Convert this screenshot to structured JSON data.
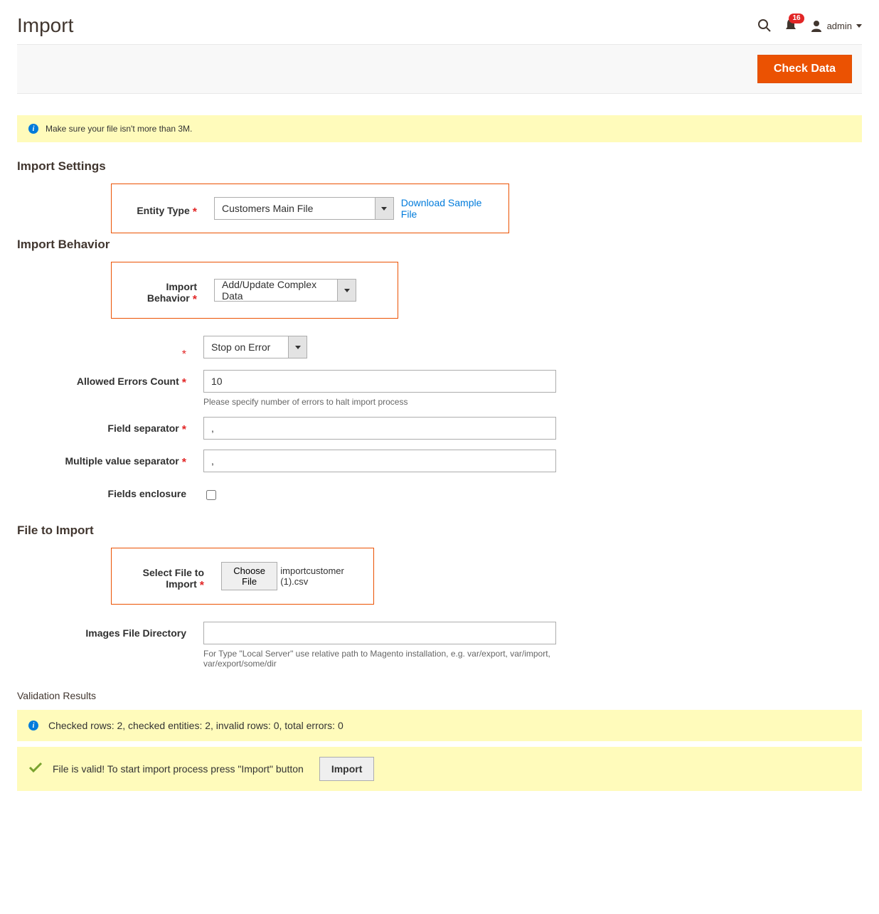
{
  "page": {
    "title": "Import"
  },
  "header": {
    "notif_count": "16",
    "username": "admin"
  },
  "actions": {
    "check_data": "Check Data"
  },
  "banner": {
    "file_size": "Make sure your file isn't more than 3M."
  },
  "sections": {
    "import_settings": "Import Settings",
    "import_behavior": "Import Behavior",
    "file_to_import": "File to Import",
    "validation_results": "Validation Results"
  },
  "labels": {
    "entity_type": "Entity Type",
    "import_behavior": "Import Behavior",
    "allowed_errors": "Allowed Errors Count",
    "field_separator": "Field separator",
    "multi_separator": "Multiple value separator",
    "fields_enclosure": "Fields enclosure",
    "select_file": "Select File to Import",
    "images_dir": "Images File Directory",
    "choose_file": "Choose File",
    "download_sample": "Download Sample File"
  },
  "values": {
    "entity_type": "Customers Main File",
    "import_behavior": "Add/Update Complex Data",
    "validation_strategy": "Stop on Error",
    "allowed_errors": "10",
    "field_separator": ",",
    "multi_separator": ",",
    "file_name": "importcustomer (1).csv",
    "images_dir": ""
  },
  "notes": {
    "allowed_errors": "Please specify number of errors to halt import process",
    "images_dir": "For Type \"Local Server\" use relative path to Magento installation, e.g. var/export, var/import, var/export/some/dir"
  },
  "results": {
    "summary": "Checked rows: 2, checked entities: 2, invalid rows: 0, total errors: 0",
    "valid_msg": "File is valid! To start import process press \"Import\" button",
    "import_btn": "Import"
  }
}
